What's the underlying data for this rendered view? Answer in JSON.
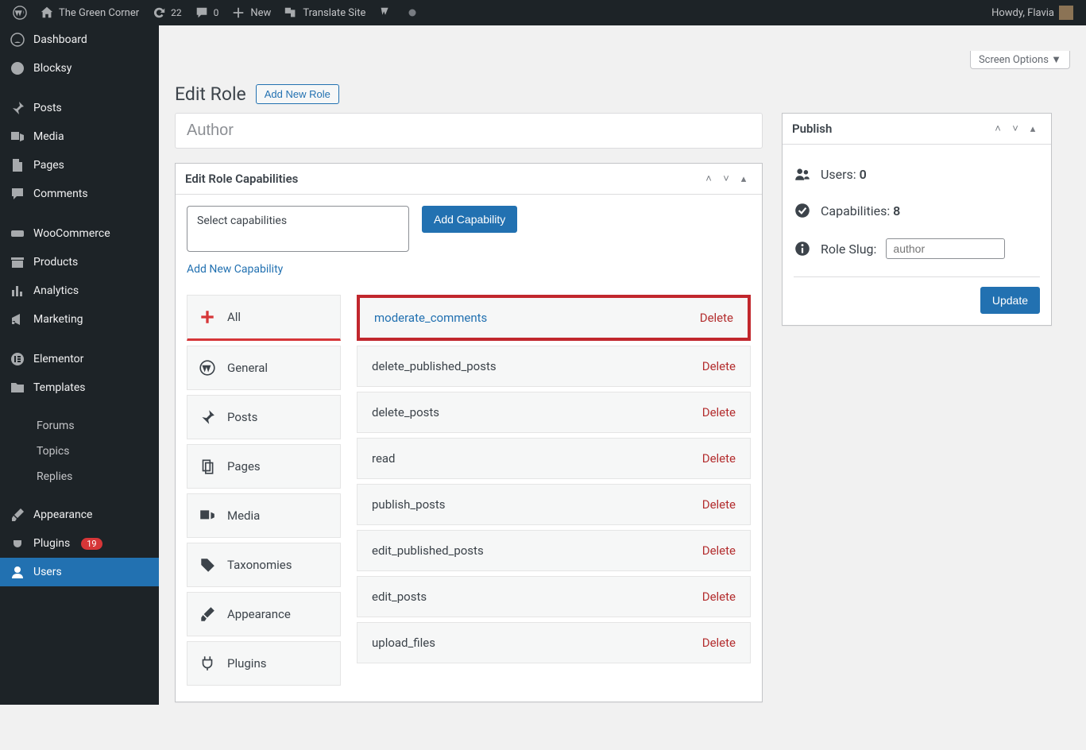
{
  "adminbar": {
    "site": "The Green Corner",
    "updates": "22",
    "comments": "0",
    "new": "New",
    "translate": "Translate Site",
    "howdy": "Howdy, Flavia"
  },
  "sidebar": {
    "dashboard": "Dashboard",
    "blocksy": "Blocksy",
    "posts": "Posts",
    "media": "Media",
    "pages": "Pages",
    "comments": "Comments",
    "woocommerce": "WooCommerce",
    "products": "Products",
    "analytics": "Analytics",
    "marketing": "Marketing",
    "elementor": "Elementor",
    "templates": "Templates",
    "forums": "Forums",
    "topics": "Topics",
    "replies": "Replies",
    "appearance": "Appearance",
    "plugins": "Plugins",
    "plugins_badge": "19",
    "users": "Users"
  },
  "page": {
    "screen_options": "Screen Options ▼",
    "title": "Edit Role",
    "add_new_role": "Add New Role",
    "role_value": "Author"
  },
  "caps_box": {
    "title": "Edit Role Capabilities",
    "select_placeholder": "Select capabilities",
    "add_capability": "Add Capability",
    "add_new_cap": "Add New Capability",
    "cats": {
      "all": "All",
      "general": "General",
      "posts": "Posts",
      "pages": "Pages",
      "media": "Media",
      "tax": "Taxonomies",
      "appearance": "Appearance",
      "plugins": "Plugins"
    },
    "delete_label": "Delete",
    "rows": [
      "moderate_comments",
      "delete_published_posts",
      "delete_posts",
      "read",
      "publish_posts",
      "edit_published_posts",
      "edit_posts",
      "upload_files"
    ]
  },
  "publish": {
    "title": "Publish",
    "users_label": "Users: ",
    "users_count": "0",
    "caps_label": "Capabilities: ",
    "caps_count": "8",
    "slug_label": "Role Slug:",
    "slug_value": "author",
    "update": "Update"
  }
}
